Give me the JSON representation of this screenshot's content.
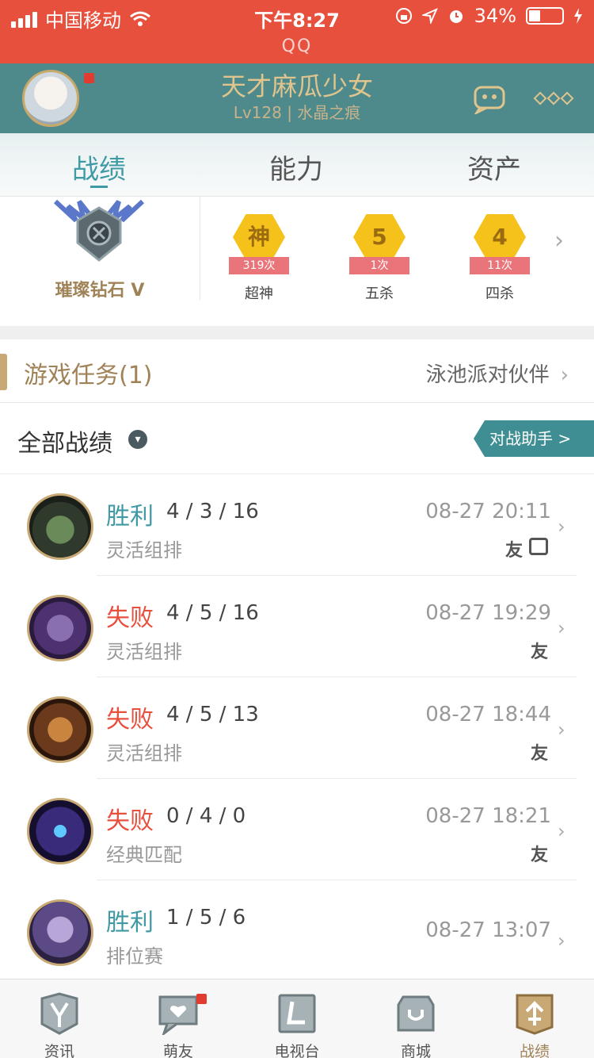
{
  "status_bar": {
    "carrier": "中国移动",
    "time": "下午8:27",
    "battery": "34%",
    "app_name": "QQ"
  },
  "profile": {
    "name": "天才麻瓜少女",
    "level": "Lv128 | 水晶之痕"
  },
  "tabs": [
    {
      "label": "战绩",
      "active": true
    },
    {
      "label": "能力",
      "active": false
    },
    {
      "label": "资产",
      "active": false
    }
  ],
  "rank": {
    "name": "璀璨钻石 V"
  },
  "badges": [
    {
      "symbol": "神",
      "count": "319次",
      "label": "超神"
    },
    {
      "symbol": "5",
      "count": "1次",
      "label": "五杀"
    },
    {
      "symbol": "4",
      "count": "11次",
      "label": "四杀"
    }
  ],
  "quest": {
    "title": "游戏任务(1)",
    "right_text": "泳池派对伙伴"
  },
  "matches_header": {
    "title": "全部战绩",
    "assist_button": "对战助手 >"
  },
  "matches": [
    {
      "result": "胜利",
      "kda": "4 / 3 / 16",
      "mode": "灵活组排",
      "time": "08-27 20:11",
      "friend_tag": "友",
      "outcome": "win",
      "video": true
    },
    {
      "result": "失败",
      "kda": "4 / 5 / 16",
      "mode": "灵活组排",
      "time": "08-27 19:29",
      "friend_tag": "友",
      "outcome": "loss",
      "video": false
    },
    {
      "result": "失败",
      "kda": "4 / 5 / 13",
      "mode": "灵活组排",
      "time": "08-27 18:44",
      "friend_tag": "友",
      "outcome": "loss",
      "video": false
    },
    {
      "result": "失败",
      "kda": "0 / 4 / 0",
      "mode": "经典匹配",
      "time": "08-27 18:21",
      "friend_tag": "友",
      "outcome": "loss",
      "video": false
    },
    {
      "result": "胜利",
      "kda": "1 / 5 / 6",
      "mode": "排位赛",
      "time": "08-27 13:07",
      "friend_tag": "",
      "outcome": "win",
      "video": false
    }
  ],
  "bottom_nav": [
    {
      "label": "资讯",
      "icon": "news-icon"
    },
    {
      "label": "萌友",
      "icon": "friends-icon",
      "badge": true
    },
    {
      "label": "电视台",
      "icon": "tv-icon"
    },
    {
      "label": "商城",
      "icon": "store-icon"
    },
    {
      "label": "战绩",
      "icon": "record-icon",
      "active": true
    }
  ],
  "colors": {
    "status_bar": "#e8503e",
    "profile_bar": "#4e8a8c",
    "gold": "#c8a976",
    "win": "#3f9aa6",
    "loss": "#e8503e"
  }
}
